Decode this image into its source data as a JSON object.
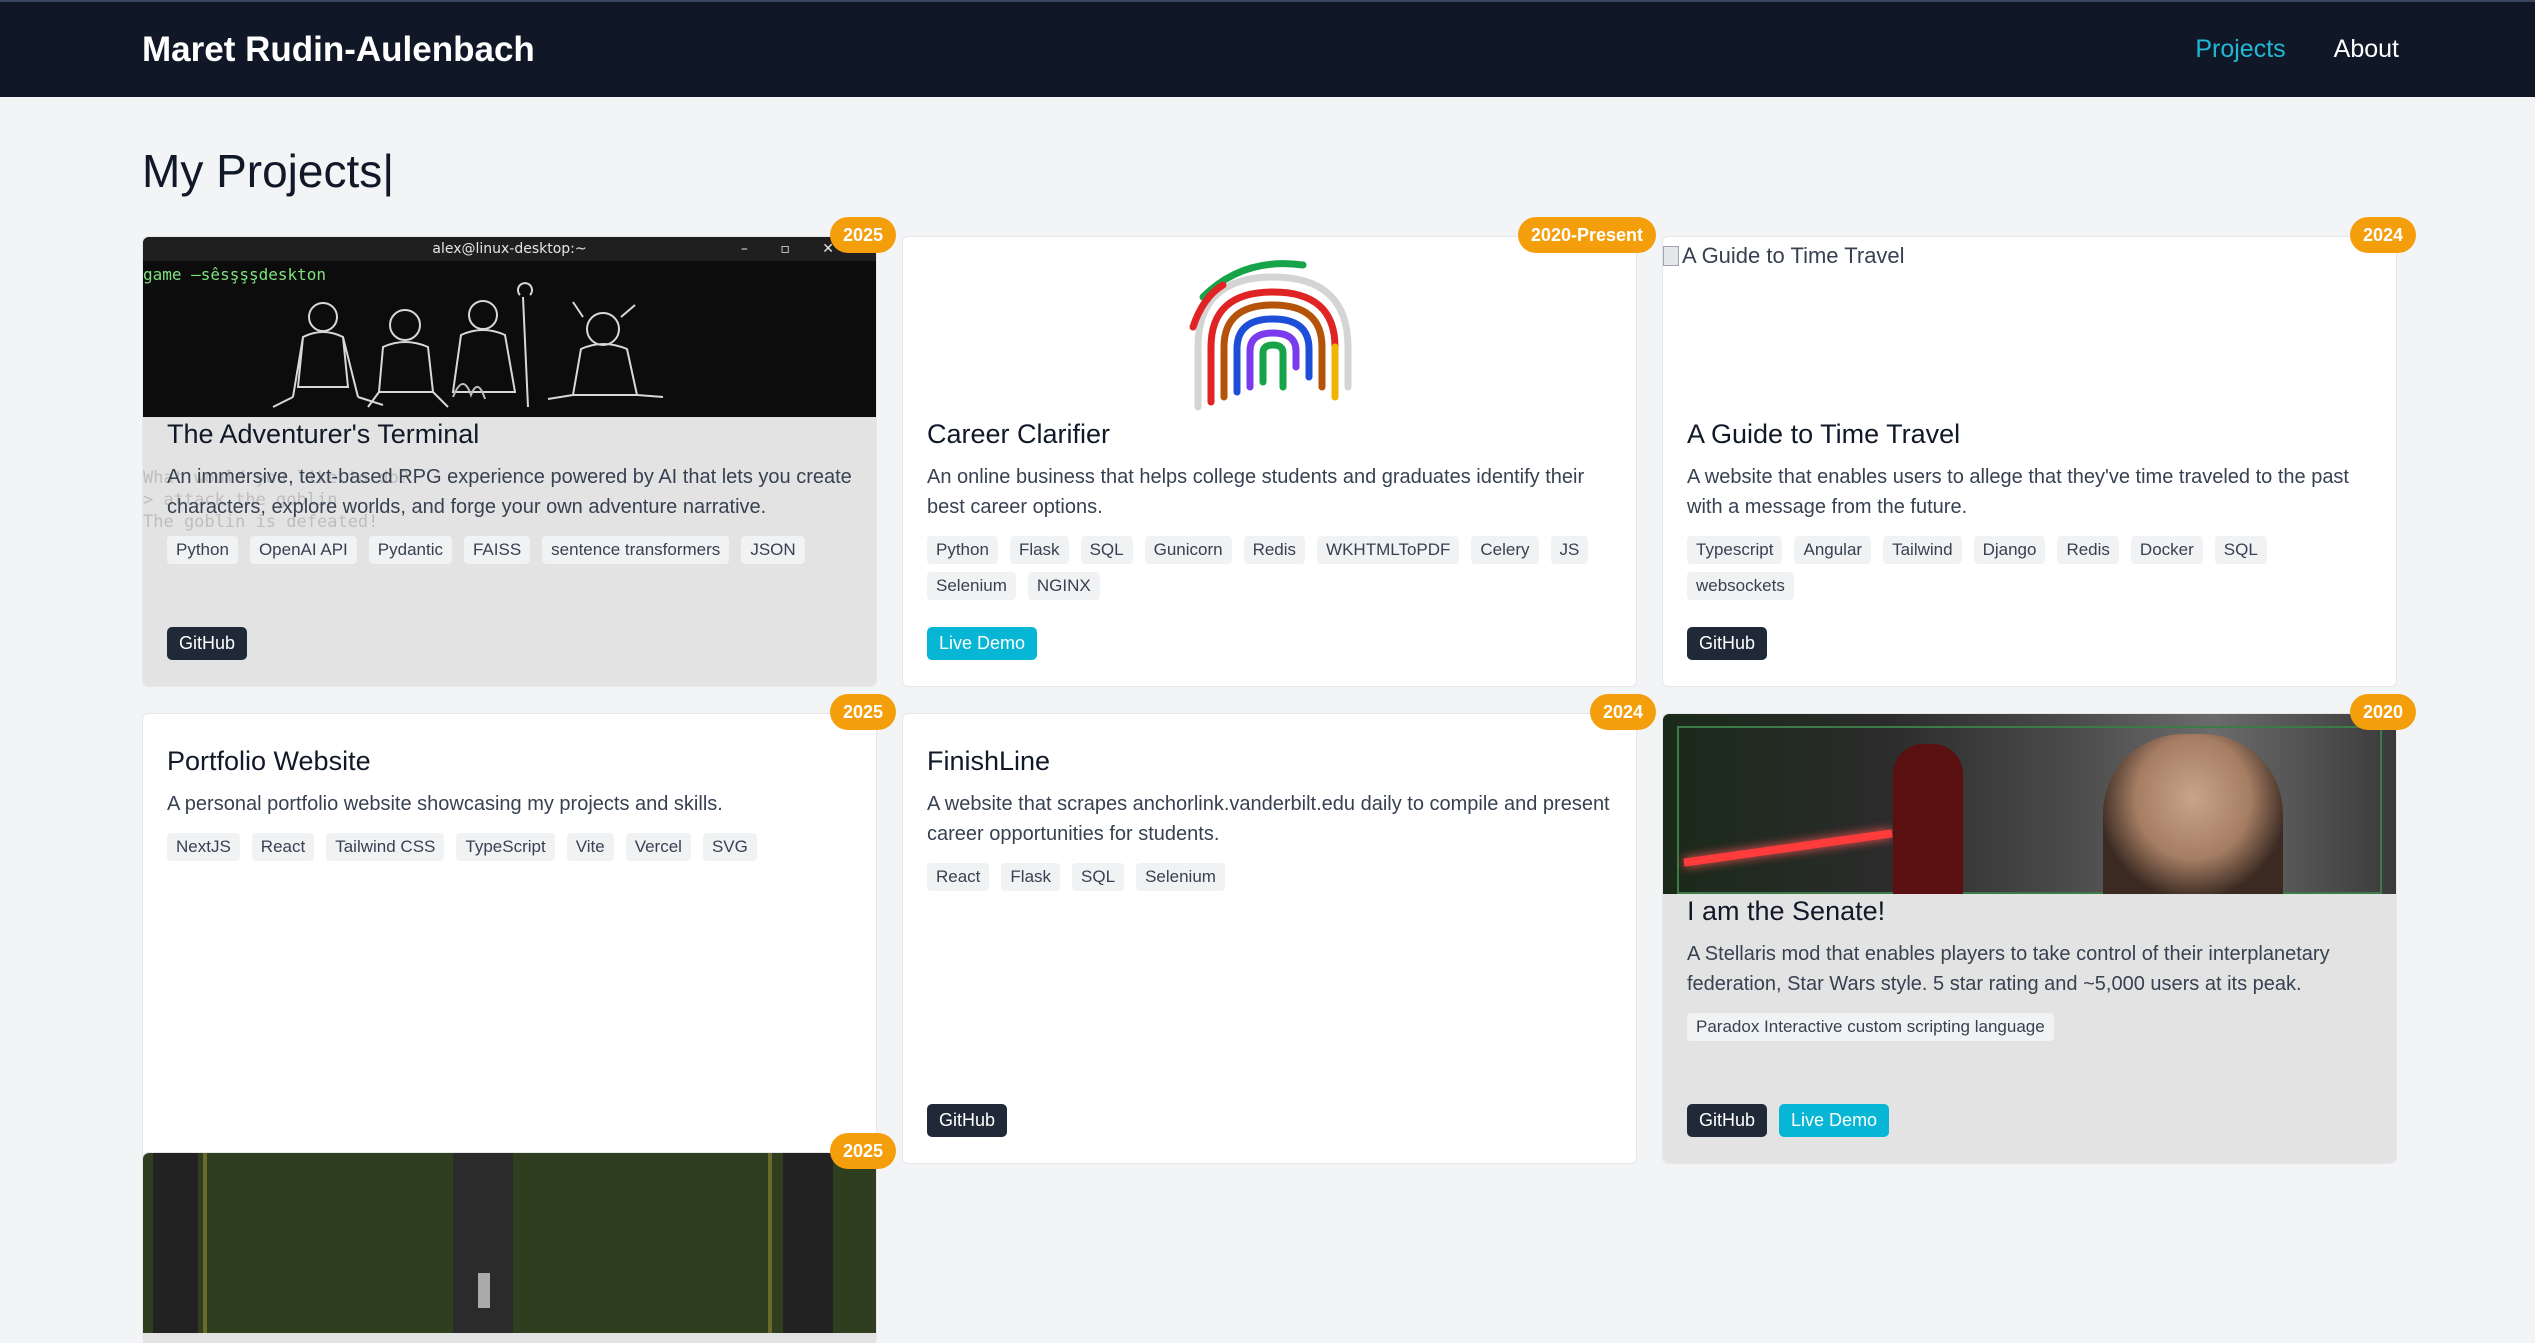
{
  "header": {
    "brand": "Maret Rudin-Aulenbach",
    "nav": [
      {
        "label": "Projects",
        "active": true
      },
      {
        "label": "About",
        "active": false
      }
    ]
  },
  "page_title": "My Projects|",
  "projects": [
    {
      "year": "2025",
      "title": "The Adventurer's Terminal",
      "description": "An immersive, text-based RPG experience powered by AI that lets you create characters, explore worlds, and forge your own adventure narrative.",
      "tags": [
        "Python",
        "OpenAI API",
        "Pydantic",
        "FAISS",
        "sentence transformers",
        "JSON"
      ],
      "buttons": [
        "GitHub"
      ],
      "image": {
        "window_title": "alex@linux-desktop:~",
        "prompt_line": "game —sêsşşşdeskton",
        "background_lines": [
          "What would you like to do?",
          "> attack the goblin",
          "The goblin is defeated!"
        ]
      }
    },
    {
      "year": "2020-Present",
      "title": "Career Clarifier",
      "description": "An online business that helps college students and graduates identify their best career options.",
      "tags": [
        "Python",
        "Flask",
        "SQL",
        "Gunicorn",
        "Redis",
        "WKHTMLToPDF",
        "Celery",
        "JS",
        "Selenium",
        "NGINX"
      ],
      "buttons": [
        "Live Demo"
      ]
    },
    {
      "year": "2024",
      "title": "A Guide to Time Travel",
      "description": "A website that enables users to allege that they've time traveled to the past with a message from the future.",
      "tags": [
        "Typescript",
        "Angular",
        "Tailwind",
        "Django",
        "Redis",
        "Docker",
        "SQL",
        "websockets"
      ],
      "buttons": [
        "GitHub"
      ],
      "image_alt": "A Guide to Time Travel"
    },
    {
      "year": "2025",
      "title": "Portfolio Website",
      "description": "A personal portfolio website showcasing my projects and skills.",
      "tags": [
        "NextJS",
        "React",
        "Tailwind CSS",
        "TypeScript",
        "Vite",
        "Vercel",
        "SVG"
      ],
      "buttons": []
    },
    {
      "year": "2024",
      "title": "FinishLine",
      "description": "A website that scrapes anchorlink.vanderbilt.edu daily to compile and present career opportunities for students.",
      "tags": [
        "React",
        "Flask",
        "SQL",
        "Selenium"
      ],
      "buttons": [
        "GitHub"
      ]
    },
    {
      "year": "2020",
      "title": "I am the Senate!",
      "description": "A Stellaris mod that enables players to take control of their interplanetary federation, Star Wars style. 5 star rating and ~5,000 users at its peak.",
      "tags": [
        "Paradox Interactive custom scripting language"
      ],
      "buttons": [
        "GitHub",
        "Live Demo"
      ]
    },
    {
      "year": "2025"
    }
  ],
  "colors": {
    "nav_bg": "#101828",
    "accent": "#22b8d4",
    "year_badge": "#f59e0b",
    "btn_dark": "#1f2937",
    "btn_cyan": "#06b6d4"
  }
}
